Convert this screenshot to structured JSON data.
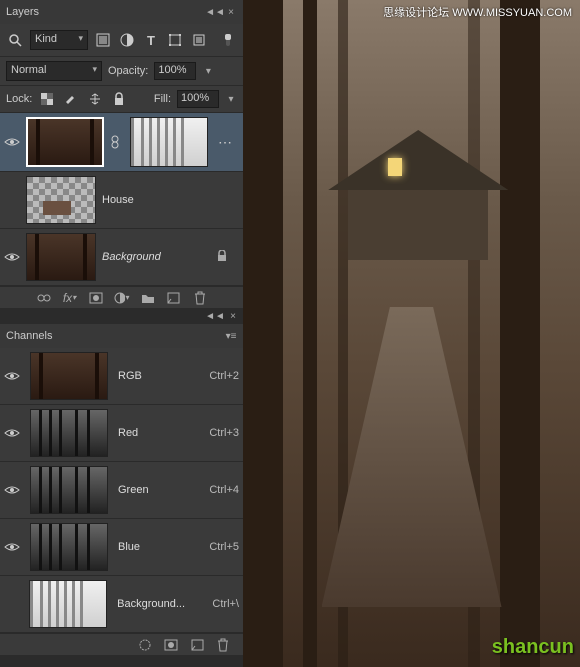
{
  "layers_panel": {
    "title": "Layers",
    "kind_label": "Kind",
    "blend_mode": "Normal",
    "opacity_label": "Opacity:",
    "opacity_value": "100%",
    "lock_label": "Lock:",
    "fill_label": "Fill:",
    "fill_value": "100%"
  },
  "layers": [
    {
      "name": "",
      "has_mask": true
    },
    {
      "name": "House"
    },
    {
      "name": "Background",
      "locked": true,
      "italic": true
    }
  ],
  "channels_panel": {
    "title": "Channels"
  },
  "channels": [
    {
      "name": "RGB",
      "shortcut": "Ctrl+2"
    },
    {
      "name": "Red",
      "shortcut": "Ctrl+3"
    },
    {
      "name": "Green",
      "shortcut": "Ctrl+4"
    },
    {
      "name": "Blue",
      "shortcut": "Ctrl+5"
    },
    {
      "name": "Background...",
      "shortcut": "Ctrl+\\"
    }
  ],
  "watermarks": {
    "top": "思缘设计论坛  WWW.MISSYUAN.COM",
    "bottom": "shancun"
  }
}
